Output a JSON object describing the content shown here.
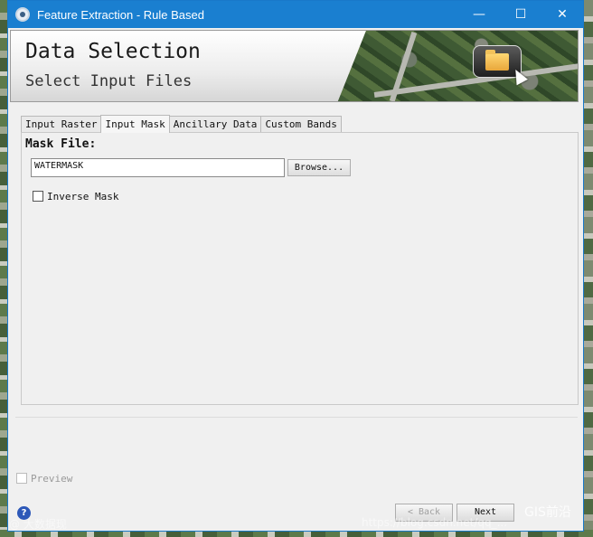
{
  "window": {
    "title": "Feature Extraction - Rule Based",
    "controls": {
      "minimize": "—",
      "maximize": "☐",
      "close": "✕"
    }
  },
  "banner": {
    "title": "Data Selection",
    "subtitle": "Select Input Files"
  },
  "tabs": [
    {
      "label": "Input Raster",
      "active": false
    },
    {
      "label": "Input Mask",
      "active": true
    },
    {
      "label": "Ancillary Data",
      "active": false
    },
    {
      "label": "Custom Bands",
      "active": false
    }
  ],
  "mask_panel": {
    "label": "Mask File:",
    "file_value": "WATERMASK",
    "browse_label": "Browse...",
    "inverse_mask_label": "Inverse Mask",
    "inverse_mask_checked": false
  },
  "preview": {
    "label": "Preview",
    "checked": false,
    "enabled": false
  },
  "footer": {
    "back_label": "< Back",
    "next_label": "Next",
    "help_icon": "?"
  },
  "watermarks": {
    "left": "@ 大数据现",
    "right": "https://blog.csdn.net/qq_...",
    "brand": "GIS前沿"
  }
}
